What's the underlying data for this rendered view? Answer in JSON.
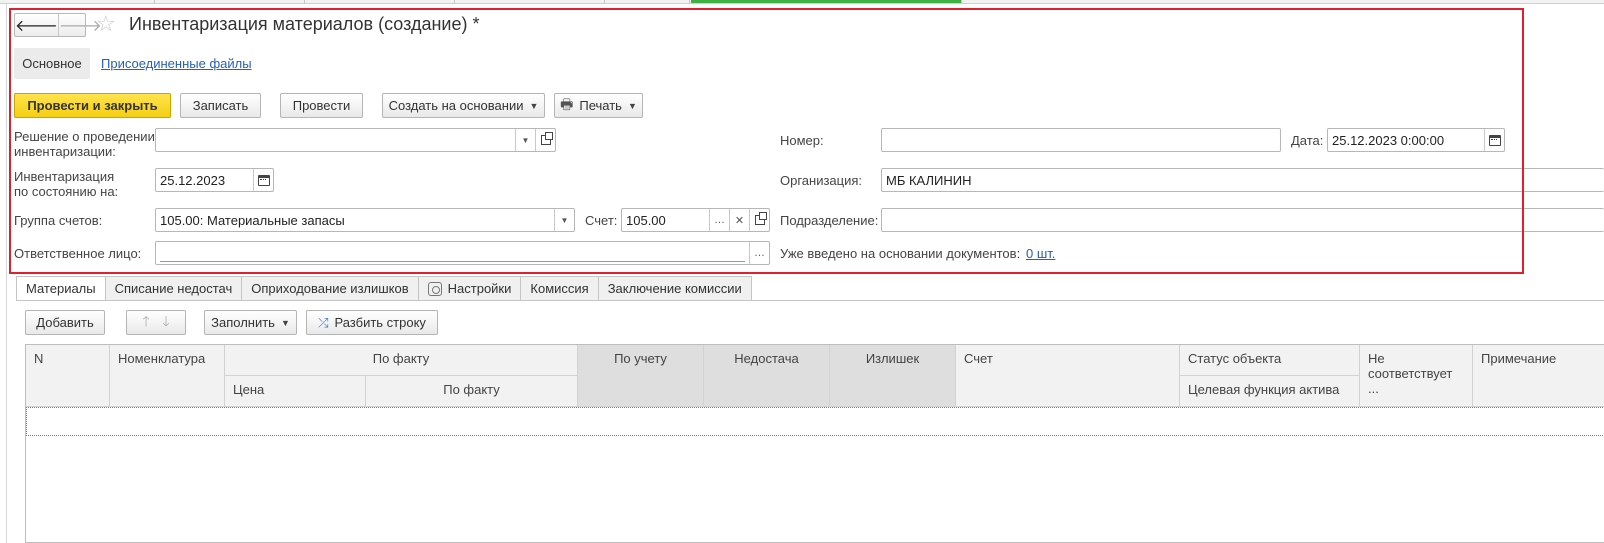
{
  "window": {
    "title": "Инвентаризация материалов (создание) *"
  },
  "nav": {
    "back_icon": "arrow-left-icon",
    "forward_icon": "arrow-right-icon",
    "favorite_icon": "star-icon"
  },
  "subtabs": {
    "main": "Основное",
    "files": "Присоединенные файлы"
  },
  "toolbar": {
    "post_close": "Провести и закрыть",
    "save": "Записать",
    "post": "Провести",
    "create_based": "Создать на основании",
    "print": "Печать"
  },
  "form": {
    "decision_label": "Решение о проведении\nинвентаризации:",
    "decision_value": "",
    "number_label": "Номер:",
    "number_value": "",
    "date_label": "Дата:",
    "date_value": "25.12.2023  0:00:00",
    "state_label": "Инвентаризация\nпо состоянию на:",
    "state_value": "25.12.2023",
    "org_label": "Организация:",
    "org_value": "МБ КАЛИНИН",
    "group_label": "Группа счетов:",
    "group_value": "105.00: Материальные запасы",
    "account_label": "Счет:",
    "account_value": "105.00",
    "subdivision_label": "Подразделение:",
    "subdivision_value": "",
    "responsible_label": "Ответственное лицо:",
    "responsible_value": "",
    "based_docs_label": "Уже введено на основании документов:",
    "based_docs_value": "0 шт."
  },
  "tabs": [
    {
      "label": "Материалы",
      "active": true
    },
    {
      "label": "Списание недостач"
    },
    {
      "label": "Оприходование излишков"
    },
    {
      "label": "Настройки"
    },
    {
      "label": "Комиссия"
    },
    {
      "label": "Заключение комиссии"
    }
  ],
  "table_toolbar": {
    "add": "Добавить",
    "fill": "Заполнить",
    "split": "Разбить строку"
  },
  "table": {
    "headers": {
      "n": "N",
      "nomenclature": "Номенклатура",
      "fact": "По факту",
      "price": "Цена",
      "fact_sub": "По факту",
      "accounting": "По учету",
      "shortage": "Недостача",
      "surplus": "Излишек",
      "account": "Счет",
      "status": "Статус объекта",
      "target_function": "Целевая функция актива",
      "not_matches": "Не соответствует ...",
      "note": "Примечание"
    }
  },
  "colors": {
    "accent_yellow": "#f5cf12",
    "highlight_red": "#e0202c",
    "link_blue": "#2860b5"
  }
}
